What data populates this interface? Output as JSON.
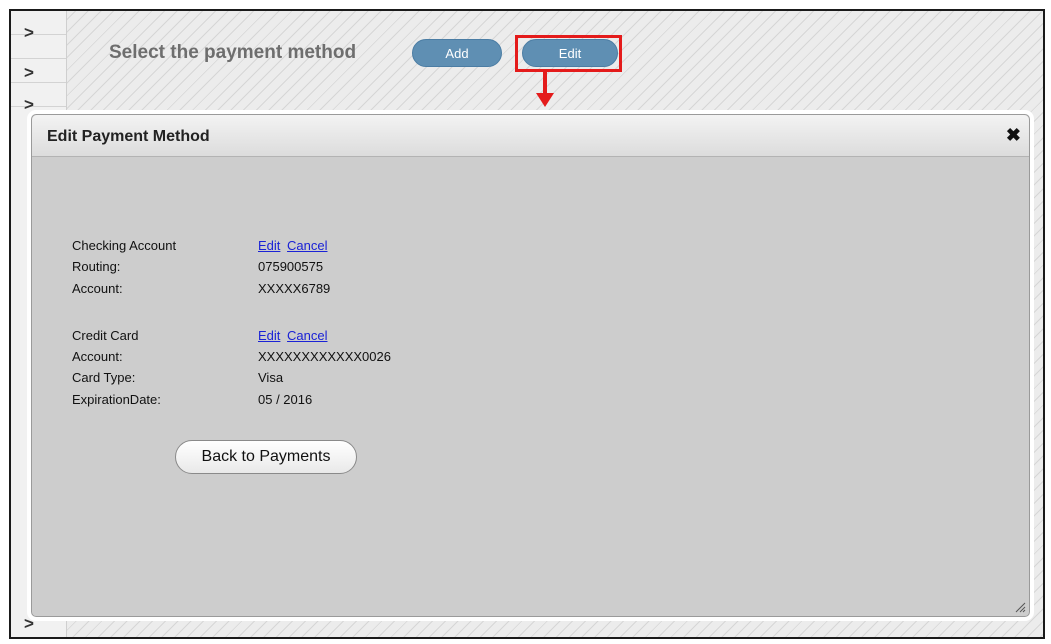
{
  "page": {
    "heading": "Select the payment method",
    "add_label": "Add",
    "edit_label": "Edit",
    "sidebar_chevrons": [
      ">",
      ">",
      ">",
      ">"
    ]
  },
  "dialog": {
    "title": "Edit Payment Method",
    "close_glyph": "✖",
    "checking": {
      "label": "Checking Account",
      "edit_link": "Edit",
      "cancel_link": "Cancel",
      "routing_label": "Routing:",
      "routing_value": "075900575",
      "account_label": "Account:",
      "account_value": "XXXXX6789"
    },
    "credit": {
      "label": "Credit Card",
      "edit_link": "Edit",
      "cancel_link": "Cancel",
      "account_label": "Account:",
      "account_value": "XXXXXXXXXXXX0026",
      "card_type_label": "Card Type:",
      "card_type_value": "Visa",
      "expiration_label": "ExpirationDate:",
      "expiration_value": "05 / 2016"
    },
    "back_button": "Back to Payments"
  },
  "colors": {
    "highlight": "#e41b1b",
    "pill": "#5f8fb3",
    "link": "#1a22d6",
    "dialog_body": "#cdcdcd"
  },
  "icons": {
    "close": "close-icon",
    "chevron": "chevron-right-icon",
    "arrow": "arrow-down-icon",
    "resize": "resize-grip-icon"
  }
}
